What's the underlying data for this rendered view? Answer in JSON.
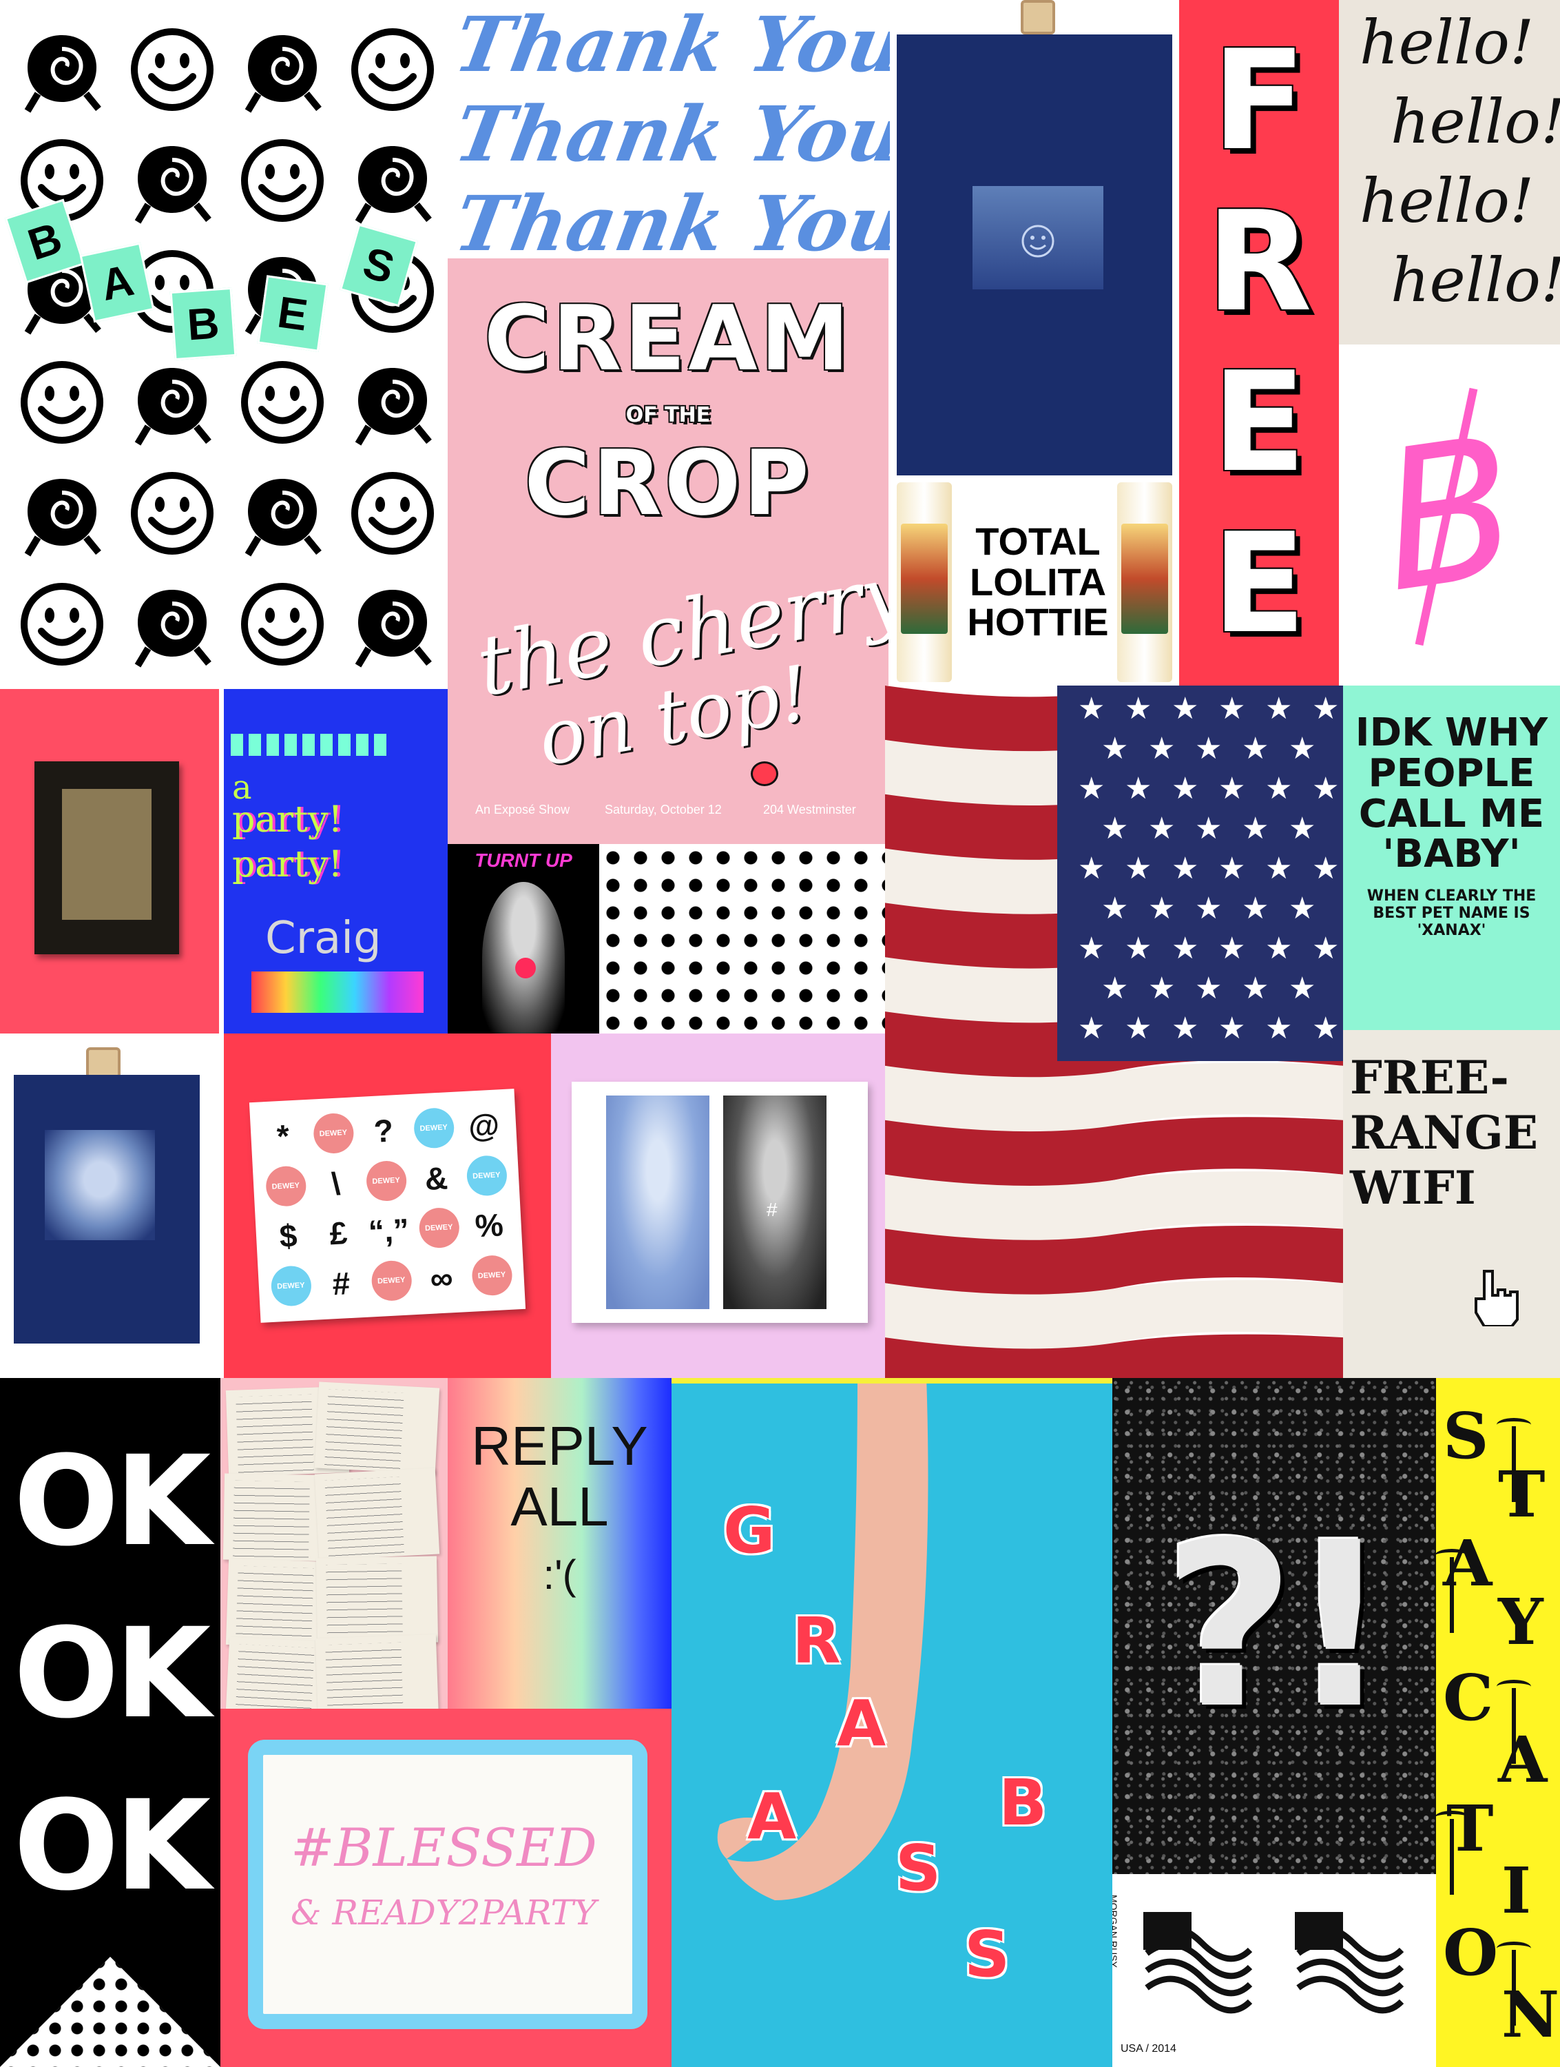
{
  "babes": {
    "letters": [
      "B",
      "A",
      "B",
      "E",
      "S"
    ]
  },
  "thanks": {
    "lines": [
      "Thank You!",
      "Thank You!",
      "Thank You!"
    ]
  },
  "cream": {
    "title1": "CREAM",
    "connector": "OF THE",
    "title2": "CROP",
    "script1": "the cherry",
    "script2": "on top!",
    "footer_left": "An Exposé Show",
    "footer_mid": "Saturday, October 12",
    "footer_right": "204 Westminster"
  },
  "candle": {
    "line1": "TOTAL",
    "line2": "LOLITA",
    "line3": "HOTTIE"
  },
  "free": {
    "letters": [
      "F",
      "R",
      "E",
      "E"
    ]
  },
  "hello": {
    "lines": [
      "hello!",
      "hello!",
      "hello!",
      "hello!"
    ]
  },
  "bdollar": {
    "glyph": "B"
  },
  "party": {
    "line1": "a",
    "line2": "party!",
    "line3": "party!",
    "line4": "Craig"
  },
  "turnt": {
    "label": "TURNT UP"
  },
  "idk": {
    "line1": "IDK WHY",
    "line2": "PEOPLE",
    "line3": "CALL ME",
    "line4": "'BABY'",
    "line5": "WHEN CLEARLY THE",
    "line6": "BEST PET NAME IS",
    "line7": "'XANAX'"
  },
  "wifi": {
    "line1": "FREE-",
    "line2": "RANGE",
    "line3": "WIFI"
  },
  "symbols": {
    "glyphs": [
      "*",
      "?",
      "@",
      "\\",
      "&",
      "$",
      "£",
      "“,”",
      "%",
      "#",
      "∞"
    ],
    "badge": "DEWEY"
  },
  "madonna": {
    "hash": "#"
  },
  "ok": {
    "lines": [
      "OK",
      "OK",
      "OK"
    ]
  },
  "reply": {
    "line1": "REPLY",
    "line2": "ALL",
    "line3": ":'("
  },
  "blessed": {
    "line1": "#BLESSED",
    "line2": "& READY2PARTY"
  },
  "grab": {
    "letters": [
      "G",
      "R",
      "A",
      "B",
      "A",
      "S",
      "S"
    ]
  },
  "qmark": {
    "glyph": "?!"
  },
  "flagsketch": {
    "sig": "MORGAN RUSY",
    "date": "USA / 2014"
  },
  "stay": {
    "letters": [
      "S",
      "T",
      "A",
      "Y",
      "C",
      "A",
      "T",
      "I",
      "O",
      "N"
    ]
  }
}
